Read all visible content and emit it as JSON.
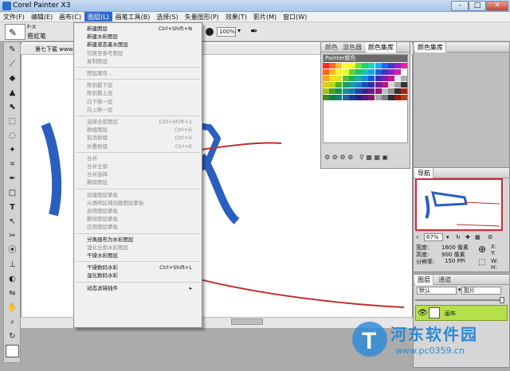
{
  "window": {
    "title": "Corel Painter X3",
    "buttons": [
      "-",
      "□",
      "✕"
    ]
  },
  "menubar": [
    {
      "label": "文件(F)",
      "active": false
    },
    {
      "label": "编辑(E)",
      "active": false
    },
    {
      "label": "画布(C)",
      "active": false
    },
    {
      "label": "图层(L)",
      "active": true
    },
    {
      "label": "画笔工具(B)",
      "active": false
    },
    {
      "label": "选择(S)",
      "active": false
    },
    {
      "label": "矢量图形(P)",
      "active": false
    },
    {
      "label": "效果(T)",
      "active": false
    },
    {
      "label": "影片(M)",
      "active": false
    },
    {
      "label": "窗口(W)",
      "active": false
    }
  ],
  "propbar": {
    "brush_category": "F-X",
    "brush_name": "霓虹笔",
    "zoom": "100%"
  },
  "document": {
    "tab_title": "第七下载 www."
  },
  "layer_menu": [
    {
      "label": "新建图层",
      "shortcut": "Ctrl+Shift+N",
      "disabled": false
    },
    {
      "label": "新建水彩图层",
      "shortcut": "",
      "disabled": false
    },
    {
      "label": "新建液态墨水图层",
      "shortcut": "",
      "disabled": false
    },
    {
      "label": "切换至参考图层",
      "shortcut": "",
      "disabled": true
    },
    {
      "label": "复制图层",
      "shortcut": "",
      "disabled": true
    },
    {
      "sep": true
    },
    {
      "label": "图层属性...",
      "shortcut": "",
      "disabled": true
    },
    {
      "sep": true
    },
    {
      "label": "移到最下层",
      "shortcut": "",
      "disabled": true
    },
    {
      "label": "移到最上层",
      "shortcut": "",
      "disabled": true
    },
    {
      "label": "向下移一层",
      "shortcut": "",
      "disabled": true
    },
    {
      "label": "向上移一层",
      "shortcut": "",
      "disabled": true
    },
    {
      "sep": true
    },
    {
      "label": "选择全部图层",
      "shortcut": "Ctrl+Shift+1",
      "disabled": true
    },
    {
      "label": "群组图层",
      "shortcut": "Ctrl+G",
      "disabled": true
    },
    {
      "label": "取消群组",
      "shortcut": "Ctrl+U",
      "disabled": true
    },
    {
      "label": "折叠群组",
      "shortcut": "Ctrl+E",
      "disabled": true
    },
    {
      "sep": true
    },
    {
      "label": "合并",
      "shortcut": "",
      "disabled": true
    },
    {
      "label": "合并全部",
      "shortcut": "",
      "disabled": true
    },
    {
      "label": "合并选择",
      "shortcut": "",
      "disabled": true
    },
    {
      "label": "删除图层",
      "shortcut": "",
      "disabled": true
    },
    {
      "sep": true
    },
    {
      "label": "创建图层蒙板",
      "shortcut": "",
      "disabled": true
    },
    {
      "label": "从透明区域创建图层蒙板",
      "shortcut": "",
      "disabled": true
    },
    {
      "label": "启用图层蒙板",
      "shortcut": "",
      "disabled": true
    },
    {
      "label": "删除图层蒙板",
      "shortcut": "",
      "disabled": true
    },
    {
      "label": "应用图层蒙板",
      "shortcut": "",
      "disabled": true
    },
    {
      "sep": true
    },
    {
      "label": "分离画布为水彩图层",
      "shortcut": "",
      "disabled": false
    },
    {
      "label": "湿化全部水彩图层",
      "shortcut": "",
      "disabled": true
    },
    {
      "label": "干燥水彩图层",
      "shortcut": "",
      "disabled": false
    },
    {
      "sep": true
    },
    {
      "label": "干燥数码水彩",
      "shortcut": "Ctrl+Shift+L",
      "disabled": false
    },
    {
      "label": "湿化数码水彩",
      "shortcut": "",
      "disabled": false
    },
    {
      "sep": true
    },
    {
      "label": "动态滤镜插件",
      "shortcut": "▸",
      "disabled": false
    }
  ],
  "color_panel": {
    "tabs": [
      "颜色",
      "混色器",
      "颜色集库"
    ],
    "library_title": "Painter颜色",
    "swatch_colors": [
      "#d0201c",
      "#e8551a",
      "#f09a1a",
      "#f0d21a",
      "#c8e01a",
      "#52b82a",
      "#1aa85a",
      "#1aa8a0",
      "#1a8ad0",
      "#1a52c8",
      "#3a2aa8",
      "#7a1aa8",
      "#b81a8a",
      "#e0e0e0",
      "#a8a8a8",
      "#3a3a3a"
    ]
  },
  "right_panel_tab": "颜色集库",
  "navigator": {
    "tab": "导航",
    "zoom": "67%",
    "width_label": "宽度:",
    "width_value": "1600 像素",
    "height_label": "高度:",
    "height_value": "900 像素",
    "res_label": "分辨率:",
    "res_value": "150 PPI",
    "x_label": "X:",
    "y_label": "Y:",
    "w_label": "W:",
    "h_label": "H:"
  },
  "layers_panel": {
    "tabs": [
      "图层",
      "通道"
    ],
    "blend": "默认",
    "composite": "胶片",
    "layer_name": "画布"
  },
  "watermark": {
    "line1": "河东软件园",
    "line2": "www.pc0359.cn"
  }
}
